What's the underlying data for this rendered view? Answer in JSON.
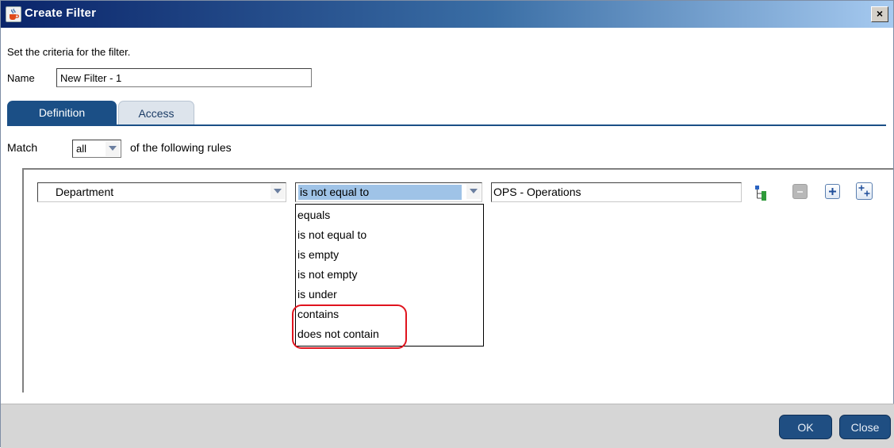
{
  "window": {
    "title": "Create Filter",
    "close_glyph": "×",
    "title_icon": "java-cup-icon"
  },
  "instructions": "Set the criteria for the filter.",
  "name": {
    "label": "Name",
    "value": "New Filter - 1"
  },
  "tabs": [
    {
      "label": "Definition",
      "selected": true
    },
    {
      "label": "Access",
      "selected": false
    }
  ],
  "match": {
    "prefix": "Match",
    "value": "all",
    "suffix": "of the following rules"
  },
  "rule": {
    "field": "Department",
    "operator": "is not equal to",
    "value": "OPS - Operations",
    "icons": [
      "tree-icon",
      "remove-rule-icon",
      "add-rule-icon",
      "add-subrule-icon"
    ]
  },
  "operator_options": [
    "equals",
    "is not equal to",
    "is empty",
    "is not empty",
    "is under",
    "contains",
    "does not contain"
  ],
  "annotation": {
    "highlighted_options": [
      "contains",
      "does not contain"
    ],
    "color": "#e0141e"
  },
  "footer": {
    "ok_label": "OK",
    "close_label": "Close"
  },
  "colors": {
    "accent": "#1b4f86",
    "selection": "#9fc3e7",
    "footer_bg": "#d6d6d6"
  }
}
